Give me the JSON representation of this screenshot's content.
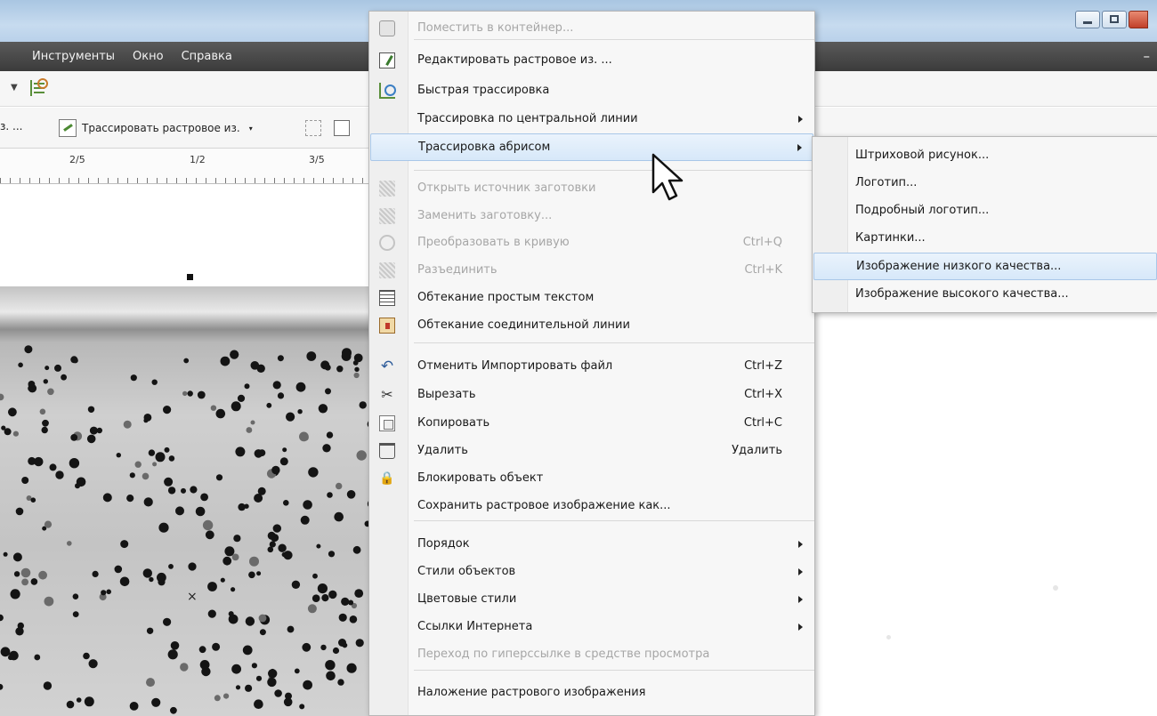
{
  "menubar": {
    "items": [
      {
        "label": "Инструменты",
        "key": "tools"
      },
      {
        "label": "Окно",
        "key": "window"
      },
      {
        "label": "Справка",
        "key": "help"
      }
    ],
    "collapse_glyph": "–"
  },
  "toolbar": {
    "lead_text": "з. ...",
    "trace_button_label": "Трассировать растровое из."
  },
  "ruler": {
    "labels": [
      "2/5",
      "1/2",
      "3/5"
    ]
  },
  "context_menu": {
    "items": [
      {
        "label": "Поместить в контейнер...",
        "shortcut": "",
        "disabled": true,
        "submenu": false,
        "icon": "container-icon"
      },
      {
        "label": "Редактировать растровое из. ...",
        "shortcut": "",
        "disabled": false,
        "submenu": false,
        "icon": "edit-bitmap-icon"
      },
      {
        "label": "Быстрая трассировка",
        "shortcut": "",
        "disabled": false,
        "submenu": false,
        "icon": "quick-trace-icon"
      },
      {
        "label": "Трассировка по центральной линии",
        "shortcut": "",
        "disabled": false,
        "submenu": true,
        "icon": ""
      },
      {
        "label": "Трассировка абрисом",
        "shortcut": "",
        "disabled": false,
        "submenu": true,
        "icon": "",
        "highlighted": true
      },
      {
        "label": "Открыть источник заготовки",
        "shortcut": "",
        "disabled": true,
        "submenu": false,
        "icon": "open-source-icon"
      },
      {
        "label": "Заменить заготовку...",
        "shortcut": "",
        "disabled": true,
        "submenu": false,
        "icon": "replace-icon"
      },
      {
        "label": "Преобразовать в кривую",
        "shortcut": "Ctrl+Q",
        "disabled": true,
        "submenu": false,
        "icon": "curve-icon"
      },
      {
        "label": "Разъединить",
        "shortcut": "Ctrl+K",
        "disabled": true,
        "submenu": false,
        "icon": "break-apart-icon"
      },
      {
        "label": "Обтекание простым текстом",
        "shortcut": "",
        "disabled": false,
        "submenu": false,
        "icon": "text-wrap-icon"
      },
      {
        "label": "Обтекание соединительной линии",
        "shortcut": "",
        "disabled": false,
        "submenu": false,
        "icon": "connector-wrap-icon"
      },
      {
        "label": "Отменить Импортировать файл",
        "shortcut": "Ctrl+Z",
        "disabled": false,
        "submenu": false,
        "icon": "undo-icon"
      },
      {
        "label": "Вырезать",
        "shortcut": "Ctrl+X",
        "disabled": false,
        "submenu": false,
        "icon": "cut-icon"
      },
      {
        "label": "Копировать",
        "shortcut": "Ctrl+C",
        "disabled": false,
        "submenu": false,
        "icon": "copy-icon"
      },
      {
        "label": "Удалить",
        "shortcut": "Удалить",
        "disabled": false,
        "submenu": false,
        "icon": "delete-icon"
      },
      {
        "label": "Блокировать объект",
        "shortcut": "",
        "disabled": false,
        "submenu": false,
        "icon": "lock-icon"
      },
      {
        "label": "Сохранить растровое изображение как...",
        "shortcut": "",
        "disabled": false,
        "submenu": false,
        "icon": ""
      },
      {
        "label": "Порядок",
        "shortcut": "",
        "disabled": false,
        "submenu": true,
        "icon": ""
      },
      {
        "label": "Стили объектов",
        "shortcut": "",
        "disabled": false,
        "submenu": true,
        "icon": ""
      },
      {
        "label": "Цветовые стили",
        "shortcut": "",
        "disabled": false,
        "submenu": true,
        "icon": ""
      },
      {
        "label": "Ссылки Интернета",
        "shortcut": "",
        "disabled": false,
        "submenu": true,
        "icon": ""
      },
      {
        "label": "Переход по гиперссылке в средстве просмотра",
        "shortcut": "",
        "disabled": true,
        "submenu": false,
        "icon": ""
      },
      {
        "label": "Наложение растрового изображения",
        "shortcut": "",
        "disabled": false,
        "submenu": false,
        "icon": ""
      }
    ]
  },
  "submenu": {
    "items": [
      {
        "label": "Штриховой рисунок..."
      },
      {
        "label": "Логотип..."
      },
      {
        "label": "Подробный логотип..."
      },
      {
        "label": "Картинки..."
      },
      {
        "label": "Изображение низкого качества...",
        "highlighted": true
      },
      {
        "label": "Изображение высокого качества..."
      }
    ]
  },
  "colors": {
    "menubar_bg": "#3b3b3b",
    "highlight_bg": "#d7e8f9",
    "highlight_border": "#a9c7e8",
    "disabled_text": "#a6a6a6"
  }
}
